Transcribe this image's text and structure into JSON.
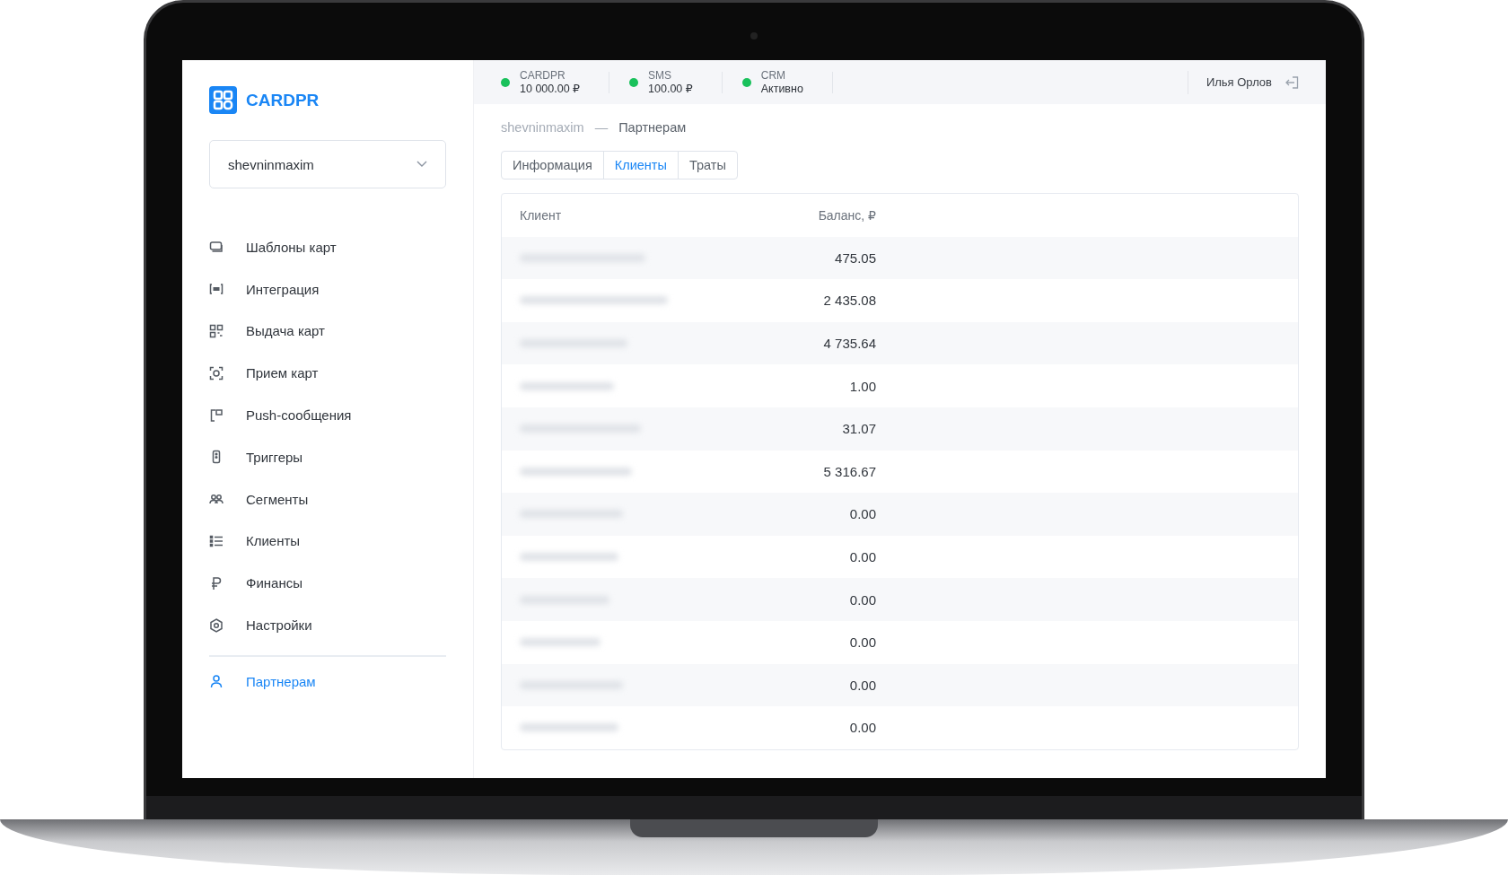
{
  "sidebar": {
    "logo": "CARDPR",
    "account_select": {
      "value": "shevninmaxim"
    },
    "items": [
      {
        "label": "Шаблоны карт",
        "selected": false
      },
      {
        "label": "Интеграция",
        "selected": false
      },
      {
        "label": "Выдача карт",
        "selected": false
      },
      {
        "label": "Прием карт",
        "selected": false
      },
      {
        "label": "Push-сообщения",
        "selected": false
      },
      {
        "label": "Триггеры",
        "selected": false
      },
      {
        "label": "Сегменты",
        "selected": false
      },
      {
        "label": "Клиенты",
        "selected": false
      },
      {
        "label": "Финансы",
        "selected": false
      },
      {
        "label": "Настройки",
        "selected": false
      }
    ],
    "footer_items": [
      {
        "label": "Партнерам",
        "selected": true
      }
    ]
  },
  "top_bar": {
    "services": [
      {
        "name": "CARDPR",
        "value": "10 000.00 ₽"
      },
      {
        "name": "SMS",
        "value": "100.00 ₽"
      },
      {
        "name": "CRM",
        "value": "Активно"
      }
    ],
    "user": "Илья Орлов"
  },
  "breadcrumb": {
    "parent": "shevninmaxim",
    "separator": "—",
    "current": "Партнерам"
  },
  "tabs": [
    {
      "label": "Информация",
      "selected": false
    },
    {
      "label": "Клиенты",
      "selected": true
    },
    {
      "label": "Траты",
      "selected": false
    }
  ],
  "table": {
    "columns": [
      "Клиент",
      "Баланс, ₽"
    ],
    "rows": [
      {
        "balance": "475.05"
      },
      {
        "balance": "2 435.08"
      },
      {
        "balance": "4 735.64"
      },
      {
        "balance": "1.00"
      },
      {
        "balance": "31.07"
      },
      {
        "balance": "5 316.67"
      },
      {
        "balance": "0.00"
      },
      {
        "balance": "0.00"
      },
      {
        "balance": "0.00"
      },
      {
        "balance": "0.00"
      },
      {
        "balance": "0.00"
      },
      {
        "balance": "0.00"
      }
    ]
  }
}
